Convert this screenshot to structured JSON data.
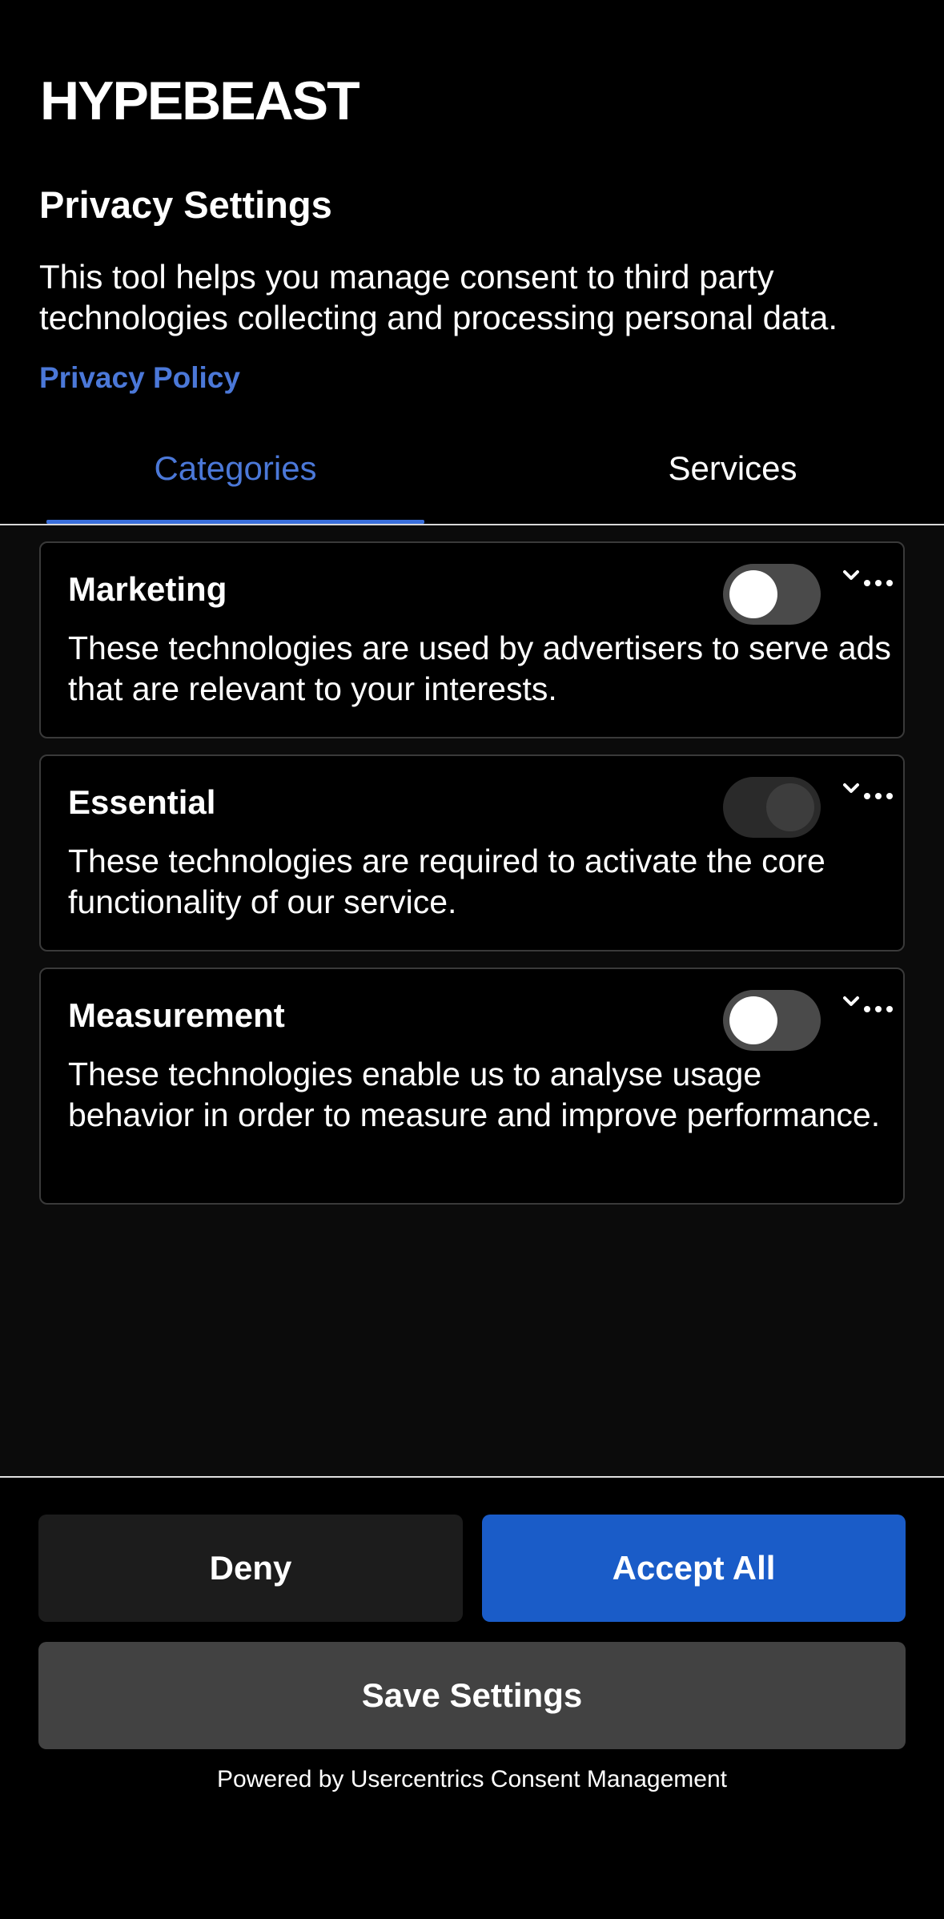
{
  "header": {
    "logo": "HYPEBEAST",
    "title": "Privacy Settings",
    "description": "This tool helps you manage consent to third party technologies collecting and processing personal data.",
    "policy_link": "Privacy Policy"
  },
  "tabs": [
    {
      "label": "Categories",
      "active": true
    },
    {
      "label": "Services",
      "active": false
    }
  ],
  "categories": [
    {
      "title": "Marketing",
      "description": "These technologies are used by advertisers to serve ads that are relevant to your interests.",
      "enabled": false,
      "toggle_disabled": false
    },
    {
      "title": "Essential",
      "description": "These technologies are required to activate the core functionality of our service.",
      "enabled": true,
      "toggle_disabled": true
    },
    {
      "title": "Measurement",
      "description": "These technologies enable us to analyse usage behavior in order to measure and improve performance.",
      "enabled": false,
      "toggle_disabled": false
    }
  ],
  "buttons": {
    "deny": "Deny",
    "accept_all": "Accept All",
    "save": "Save Settings"
  },
  "footer": {
    "powered_by": "Powered by Usercentrics Consent Management"
  },
  "colors": {
    "accent": "#4b78d8",
    "accept_button": "#1a5cc8",
    "background": "#000000"
  },
  "icons": [
    "chevron-down-icon",
    "ellipsis-icon"
  ]
}
